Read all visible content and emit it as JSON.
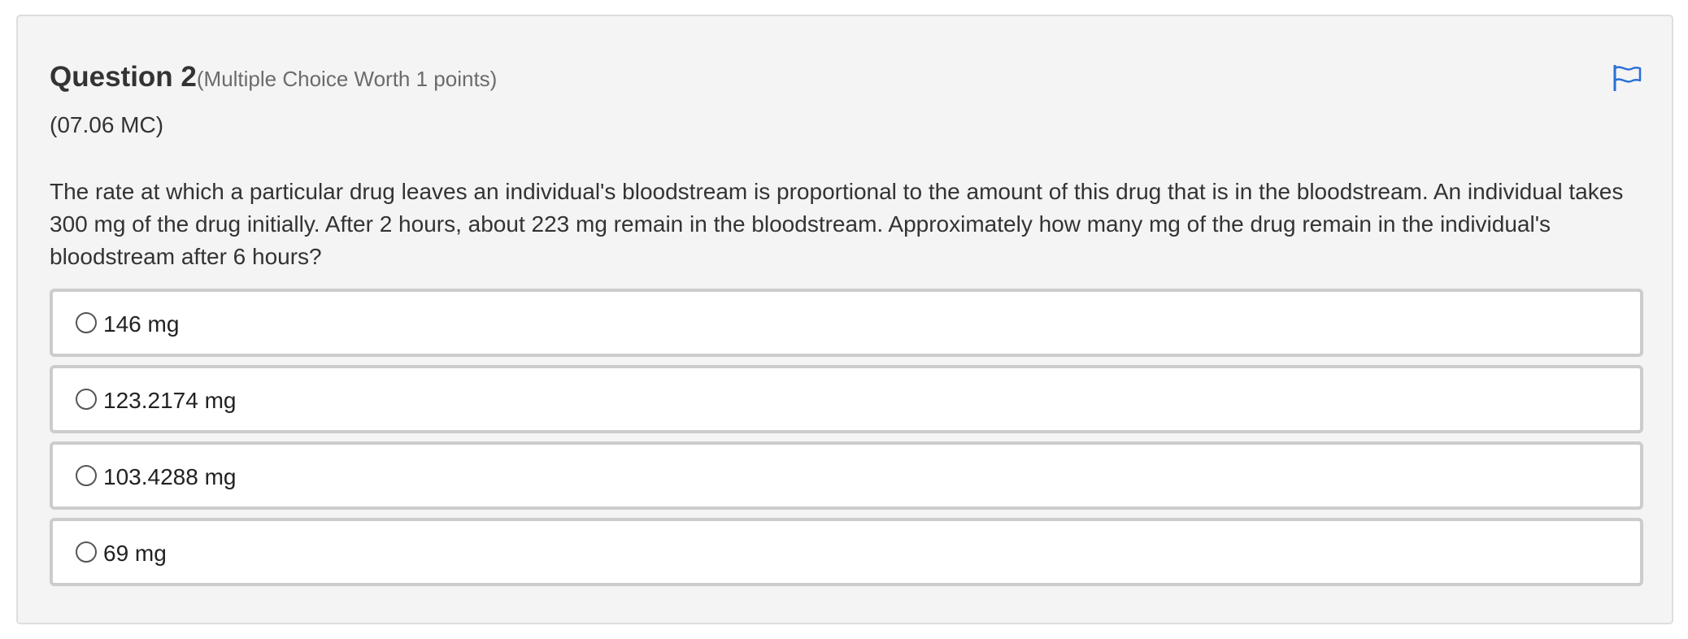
{
  "question": {
    "title": "Question 2",
    "meta": "(Multiple Choice Worth 1 points)",
    "code": "(07.06 MC)",
    "prompt": "The rate at which a particular drug leaves an individual's bloodstream is proportional to the amount of this drug that is in the bloodstream. An individual takes 300 mg of the drug initially. After 2 hours, about 223 mg remain in the bloodstream. Approximately how many mg of the drug remain in the individual's bloodstream after 6 hours?",
    "flag_icon": "flag-icon",
    "accent_color": "#2a6fd6"
  },
  "options": [
    {
      "label": "146 mg",
      "selected": false
    },
    {
      "label": "123.2174 mg",
      "selected": false
    },
    {
      "label": "103.4288 mg",
      "selected": false
    },
    {
      "label": "69 mg",
      "selected": false
    }
  ]
}
